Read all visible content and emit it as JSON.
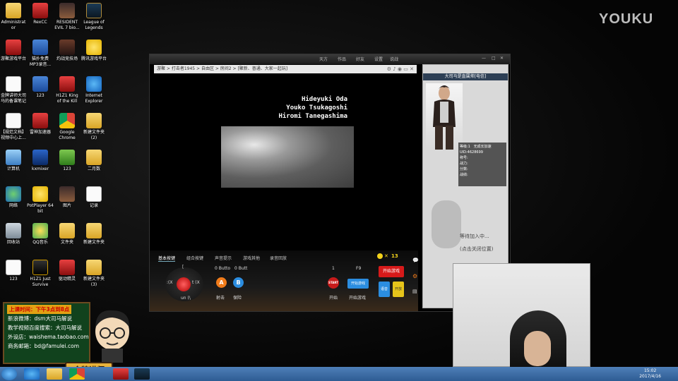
{
  "desktop": {
    "icons": [
      {
        "label": "Administrat\nor",
        "icon": "folder-icon",
        "cls": "g-folder"
      },
      {
        "label": "RexCC",
        "icon": "rexcc-icon",
        "cls": "g-red"
      },
      {
        "label": "RESIDENT\nEVIL 7 bio...",
        "icon": "resident-evil-icon",
        "cls": "g-img"
      },
      {
        "label": "League of\nLegends",
        "icon": "league-icon",
        "cls": "g-lol"
      },
      {
        "label": "游聚游戏平台",
        "icon": "youju-icon",
        "cls": "g-red"
      },
      {
        "label": "猫扑免费\nMP3录音...",
        "icon": "mp3-recorder-icon",
        "cls": "g-blue"
      },
      {
        "label": "灼战竞技场",
        "icon": "arena-icon",
        "cls": "g-dark"
      },
      {
        "label": "腾讯游戏平台",
        "icon": "tencent-game-icon",
        "cls": "g-yellow"
      },
      {
        "label": "金牌讲师大司\n马的备课笔记",
        "icon": "notes-icon",
        "cls": "g-doc"
      },
      {
        "label": "123",
        "icon": "app-123-icon",
        "cls": "g-blue"
      },
      {
        "label": "H1Z1 King\nof the Kill",
        "icon": "h1z1-kotk-icon",
        "cls": "g-red"
      },
      {
        "label": "Internet\nExplorer",
        "icon": "ie-icon",
        "cls": "g-ie"
      },
      {
        "label": "【规范文档】\n视频中心上...",
        "icon": "doc-icon",
        "cls": "g-doc"
      },
      {
        "label": "雷神加速器",
        "icon": "leishen-icon",
        "cls": "g-red"
      },
      {
        "label": "Google\nChrome",
        "icon": "chrome-icon",
        "cls": "g-chrome"
      },
      {
        "label": "新建文件夹\n(2)",
        "icon": "folder-icon",
        "cls": "g-folder"
      },
      {
        "label": "计算机",
        "icon": "computer-icon",
        "cls": "g-pc"
      },
      {
        "label": "kxmixer",
        "icon": "kxmixer-icon",
        "cls": "g-mini"
      },
      {
        "label": "123",
        "icon": "app-123-icon",
        "cls": "g-green"
      },
      {
        "label": "二月数",
        "icon": "folder-icon",
        "cls": "g-folder"
      },
      {
        "label": "网络",
        "icon": "network-icon",
        "cls": "g-globe"
      },
      {
        "label": "PotPlayer 64\nbit",
        "icon": "potplayer-icon",
        "cls": "g-yellow"
      },
      {
        "label": "图片",
        "icon": "pictures-icon",
        "cls": "g-img"
      },
      {
        "label": "记录",
        "icon": "doc-icon",
        "cls": "g-doc"
      },
      {
        "label": "回收站",
        "icon": "recycle-bin-icon",
        "cls": "g-trash"
      },
      {
        "label": "QQ音乐",
        "icon": "qqmusic-icon",
        "cls": "g-qq"
      },
      {
        "label": "文件夹",
        "icon": "folder-icon",
        "cls": "g-folder"
      },
      {
        "label": "新建文件夹",
        "icon": "folder-icon",
        "cls": "g-folder"
      },
      {
        "label": "123",
        "icon": "doc-icon",
        "cls": "g-doc"
      },
      {
        "label": "H1Z1 Just\nSurvive",
        "icon": "h1z1-survive-icon",
        "cls": "g-h1"
      },
      {
        "label": "驱动精灵",
        "icon": "driver-icon",
        "cls": "g-red"
      },
      {
        "label": "新建文件夹\n(3)",
        "icon": "folder-icon",
        "cls": "g-folder"
      }
    ]
  },
  "watermark": "YOUKU",
  "app": {
    "titlebar_items": [
      "天方",
      "作品",
      "好友",
      "设置",
      "说战"
    ],
    "breadcrumb": "游聚 > 打击者1945 > 自由区 > 房间2 > [聚新、普通、大家一起玩]",
    "credits": [
      "Hideyuki Oda",
      "Youko Tsukagoshi",
      "Hiromi Tanegashima"
    ],
    "side": {
      "header": "大司马是直属帅[电信]",
      "stats": [
        "等级:1",
        "无成长加速",
        "UID:4628699",
        "称号:",
        "战力:",
        "分数:",
        "战绩:"
      ],
      "wait_text": "等待加入中...",
      "close_text": "(点击关闭位置)"
    },
    "controls": {
      "tabs": [
        "基本按键",
        "组合按键",
        "声音提示",
        "游戏其他",
        "录音回放"
      ],
      "dpad_up": "[",
      "dpad_left": ":(X",
      "dpad_right": "t (X",
      "dpad_down": "un (\\",
      "button_label_a": "0 Butto",
      "button_label_b": "0 Butt",
      "a_label": "A",
      "b_label": "B",
      "fire_label": "射击",
      "bomb_label": "保险",
      "start_key": "1",
      "start_small": "START",
      "start_caption": "开始",
      "f9_key": "F9",
      "start_game_small": "开始游戏",
      "start_game_caption": "开始游戏",
      "coin_count": "13",
      "start_game_btn": "开始游戏",
      "voice_btn": "语音",
      "open_btn": "开放"
    }
  },
  "teacher": {
    "class_time": "上课时间：下午3点到8点",
    "lines": [
      "新浪微博：dsm大司马解说",
      "教学视频百度搜索：大司马解说",
      "外设店：waishema.taobao.com",
      "商务邮箱：bd@famulei.com"
    ],
    "badge": "金牌讲师"
  },
  "taskbar": {
    "time": "15:02",
    "date": "2017/4/16"
  }
}
